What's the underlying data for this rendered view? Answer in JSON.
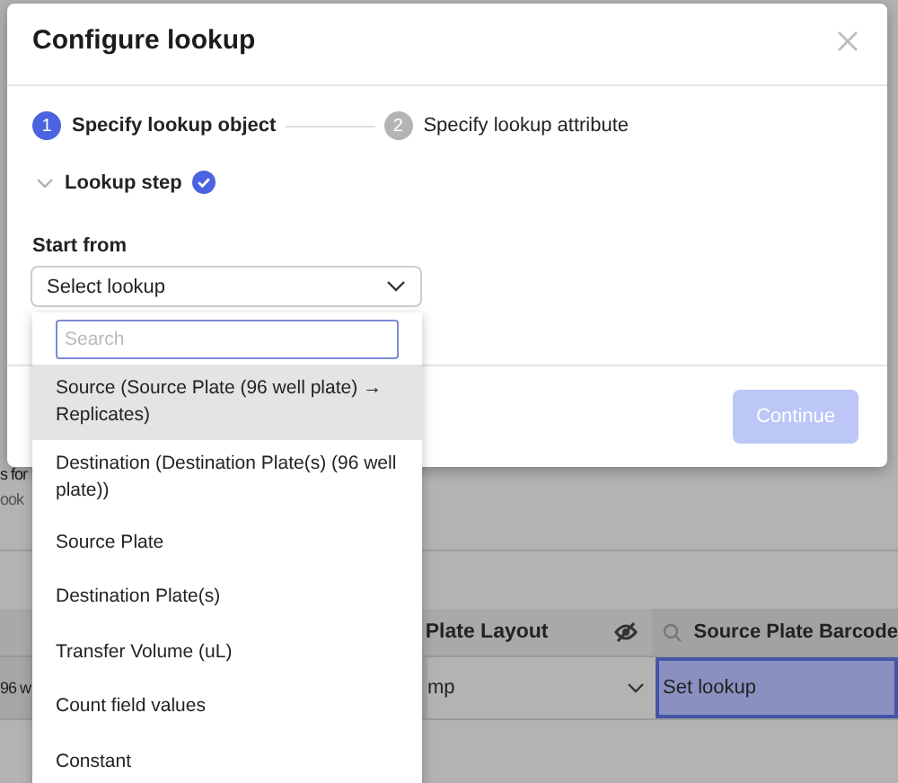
{
  "background": {
    "section_title": "s for",
    "section_subtitle": "ook",
    "table": {
      "columns": [
        {
          "label": "Plate Layout"
        },
        {
          "label": "Source Plate Barcode"
        }
      ],
      "rows": [
        {
          "row_header": "96 w",
          "cells": [
            {
              "text": "mp",
              "selected": false
            },
            {
              "text": "Set lookup",
              "selected": true
            }
          ]
        }
      ]
    }
  },
  "dialog": {
    "title": "Configure lookup",
    "steps": [
      {
        "number": "1",
        "label": "Specify lookup object",
        "selected": true
      },
      {
        "number": "2",
        "label": "Specify lookup attribute",
        "selected": false
      }
    ],
    "section": {
      "label": "Lookup step",
      "expanded": true,
      "complete": true
    },
    "field": {
      "label": "Start from",
      "value": "Select lookup"
    },
    "continue_button": {
      "label": "Continue",
      "disabled": true
    }
  },
  "dropdown": {
    "search": {
      "placeholder": "Search"
    },
    "options": [
      {
        "label": "Source (Source Plate (96 well plate) → Replicates)",
        "selected": true
      },
      {
        "label": "Destination (Destination Plate(s) (96 well plate))",
        "selected": false
      },
      {
        "label": "Source Plate",
        "selected": false
      },
      {
        "label": "Destination Plate(s)",
        "selected": false
      },
      {
        "label": "Transfer Volume (uL)",
        "selected": false
      },
      {
        "label": "Count field values",
        "selected": false
      },
      {
        "label": "Constant",
        "selected": false
      }
    ]
  }
}
